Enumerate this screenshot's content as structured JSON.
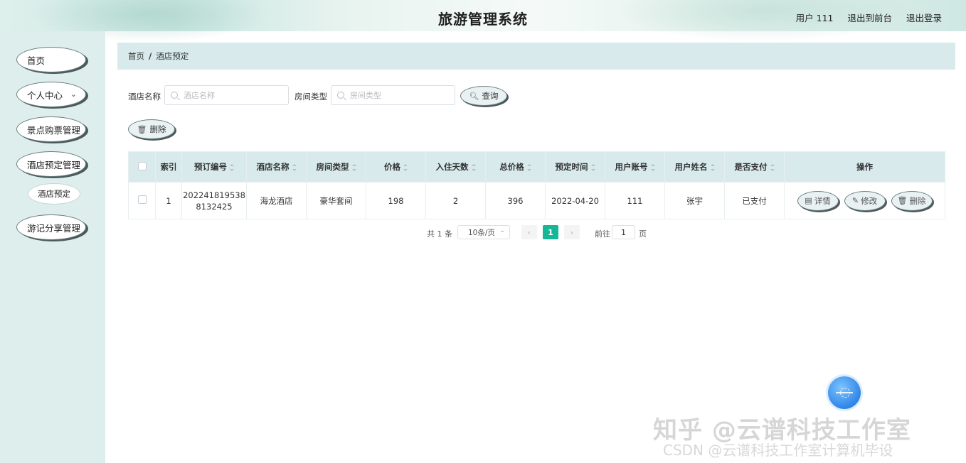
{
  "header": {
    "title": "旅游管理系统",
    "user": "用户 111",
    "exit_front": "退出到前台",
    "logout": "退出登录"
  },
  "sidebar": {
    "items": [
      {
        "label": "首页"
      },
      {
        "label": "个人中心"
      },
      {
        "label": "景点购票管理"
      },
      {
        "label": "酒店预定管理"
      },
      {
        "label": "酒店预定"
      },
      {
        "label": "游记分享管理"
      }
    ]
  },
  "breadcrumb": {
    "home": "首页",
    "separator": "/",
    "current": "酒店预定"
  },
  "search": {
    "hotel_label": "酒店名称",
    "hotel_placeholder": "酒店名称",
    "room_label": "房间类型",
    "room_placeholder": "房间类型",
    "query_button": "查询",
    "delete_button": "删除"
  },
  "table": {
    "columns": [
      "索引",
      "预订编号",
      "酒店名称",
      "房间类型",
      "价格",
      "入住天数",
      "总价格",
      "预定时间",
      "用户账号",
      "用户姓名",
      "是否支付",
      "操作"
    ],
    "rows": [
      {
        "index": "1",
        "order_no_1": "202241819538",
        "order_no_2": "8132425",
        "hotel": "海龙酒店",
        "room": "豪华套间",
        "price": "198",
        "days": "2",
        "total": "396",
        "date": "2022-04-20",
        "account": "111",
        "name": "张宇",
        "paid": "已支付"
      }
    ],
    "actions": {
      "detail": "详情",
      "edit": "修改",
      "delete": "删除"
    }
  },
  "pagination": {
    "total": "共 1 条",
    "page_size": "10条/页",
    "current_page": "1",
    "goto_label": "前往",
    "goto_value": "1",
    "page_unit": "页"
  },
  "watermark": {
    "line1": "知乎 @云谱科技工作室",
    "line2": "CSDN @云谱科技工作室计算机毕设"
  },
  "colors": {
    "accent": "#16b796",
    "sidebar_bg": "#ddeeed",
    "table_header_bg": "#d8eaec"
  }
}
